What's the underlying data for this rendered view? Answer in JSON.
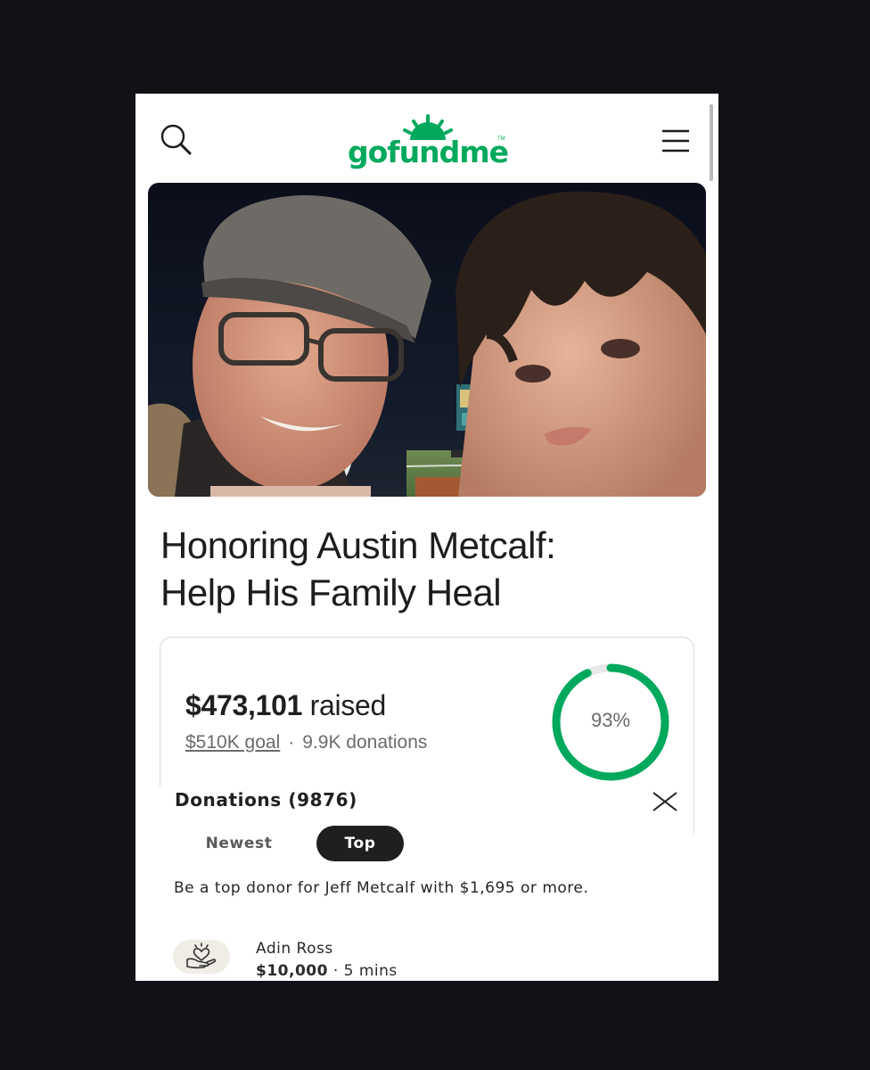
{
  "header": {
    "logo_text": "gofundme",
    "logo_tm": "TM",
    "search_icon": "search-icon",
    "menu_icon": "hamburger-menu-icon"
  },
  "hero": {
    "description": "photo"
  },
  "campaign": {
    "title_line1": "Honoring Austin Metcalf:",
    "title_line2": "Help His Family Heal"
  },
  "progress": {
    "raised_amount": "$473,101",
    "raised_label": "raised",
    "goal_text": "$510K goal",
    "separator": "·",
    "donations_text": "9.9K donations",
    "percent_label": "93%",
    "percent_value": 93,
    "accent_color": "#02a95c"
  },
  "donations_panel": {
    "title": "Donations (9876)",
    "close_icon": "close-icon",
    "tabs": [
      {
        "label": "Newest",
        "selected": false
      },
      {
        "label": "Top",
        "selected": true
      }
    ],
    "cta": "Be a top donor for Jeff Metcalf with $1,695 or more.",
    "donors": [
      {
        "name": "Adin Ross",
        "amount": "$10,000",
        "separator": "·",
        "time": "5 mins",
        "icon": "donation-hand-heart-icon"
      }
    ]
  }
}
